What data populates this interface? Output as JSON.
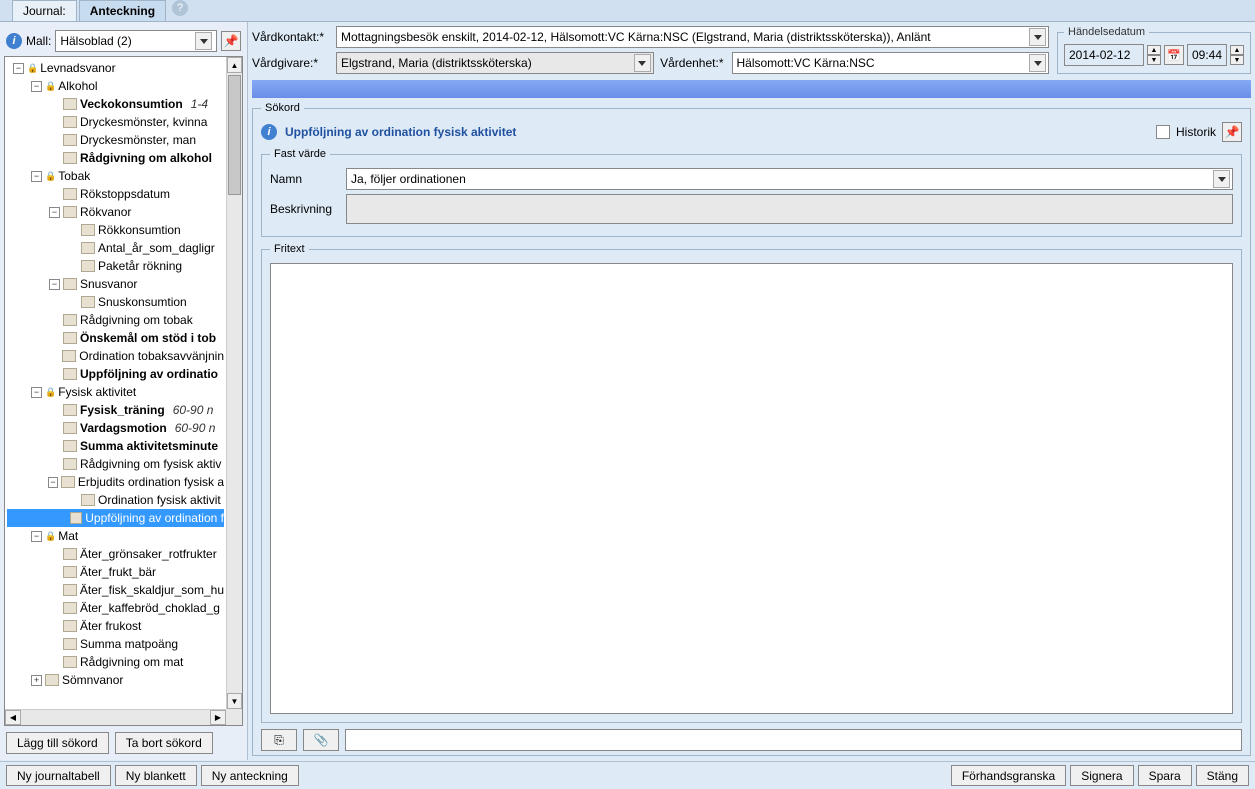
{
  "tabs": {
    "journal": "Journal:",
    "anteckning": "Anteckning"
  },
  "mall": {
    "label": "Mall:",
    "value": "Hälsoblad (2)"
  },
  "tree": [
    {
      "indent": 0,
      "toggle": "-",
      "lock": true,
      "label": "Levnadsvanor"
    },
    {
      "indent": 1,
      "toggle": "-",
      "lock": true,
      "label": "Alkohol"
    },
    {
      "indent": 2,
      "doc": true,
      "label": "Veckokonsumtion",
      "bold": true,
      "extra": "1-4"
    },
    {
      "indent": 2,
      "doc": true,
      "label": "Dryckesmönster, kvinna"
    },
    {
      "indent": 2,
      "doc": true,
      "label": "Dryckesmönster, man"
    },
    {
      "indent": 2,
      "doc": true,
      "label": "Rådgivning om alkohol",
      "bold": true
    },
    {
      "indent": 1,
      "toggle": "-",
      "lock": true,
      "label": "Tobak"
    },
    {
      "indent": 2,
      "doc": true,
      "label": "Rökstoppsdatum"
    },
    {
      "indent": 2,
      "toggle": "-",
      "doc": true,
      "label": "Rökvanor"
    },
    {
      "indent": 3,
      "doc": true,
      "label": "Rökkonsumtion"
    },
    {
      "indent": 3,
      "doc": true,
      "label": "Antal_år_som_dagligr"
    },
    {
      "indent": 3,
      "doc": true,
      "label": "Paketår rökning"
    },
    {
      "indent": 2,
      "toggle": "-",
      "doc": true,
      "label": "Snusvanor"
    },
    {
      "indent": 3,
      "doc": true,
      "label": "Snuskonsumtion"
    },
    {
      "indent": 2,
      "doc": true,
      "label": "Rådgivning om tobak"
    },
    {
      "indent": 2,
      "doc": true,
      "label": "Önskemål om stöd i tob",
      "bold": true
    },
    {
      "indent": 2,
      "doc": true,
      "label": "Ordination tobaksavvänjnin"
    },
    {
      "indent": 2,
      "doc": true,
      "label": "Uppföljning av ordinatio",
      "bold": true
    },
    {
      "indent": 1,
      "toggle": "-",
      "lock": true,
      "label": "Fysisk aktivitet"
    },
    {
      "indent": 2,
      "doc": true,
      "label": "Fysisk_träning",
      "bold": true,
      "extra": "60-90 n"
    },
    {
      "indent": 2,
      "doc": true,
      "label": "Vardagsmotion",
      "bold": true,
      "extra": "60-90 n"
    },
    {
      "indent": 2,
      "doc": true,
      "label": "Summa aktivitetsminute",
      "bold": true
    },
    {
      "indent": 2,
      "doc": true,
      "label": "Rådgivning om fysisk aktiv"
    },
    {
      "indent": 2,
      "toggle": "-",
      "doc": true,
      "label": "Erbjudits ordination fysisk a"
    },
    {
      "indent": 3,
      "doc": true,
      "label": "Ordination fysisk aktivit"
    },
    {
      "indent": 3,
      "doc": true,
      "label": "Uppföljning av ordination f",
      "selected": true
    },
    {
      "indent": 1,
      "toggle": "-",
      "lock": true,
      "label": "Mat"
    },
    {
      "indent": 2,
      "doc": true,
      "label": "Äter_grönsaker_rotfrukter"
    },
    {
      "indent": 2,
      "doc": true,
      "label": "Äter_frukt_bär"
    },
    {
      "indent": 2,
      "doc": true,
      "label": "Äter_fisk_skaldjur_som_hu"
    },
    {
      "indent": 2,
      "doc": true,
      "label": "Äter_kaffebröd_choklad_g"
    },
    {
      "indent": 2,
      "doc": true,
      "label": "Äter frukost"
    },
    {
      "indent": 2,
      "doc": true,
      "label": "Summa matpoäng"
    },
    {
      "indent": 2,
      "doc": true,
      "label": "Rådgivning om mat"
    },
    {
      "indent": 1,
      "toggle": "+",
      "doc": true,
      "label": "Sömnvanor"
    }
  ],
  "leftButtons": {
    "add": "Lägg till sökord",
    "remove": "Ta bort sökord"
  },
  "form": {
    "vardkontakt_label": "Vårdkontakt:*",
    "vardkontakt_value": "Mottagningsbesök enskilt, 2014-02-12, Hälsomott:VC Kärna:NSC (Elgstrand, Maria (distriktssköterska)), Anlänt",
    "vardgivare_label": "Vårdgivare:*",
    "vardgivare_value": "Elgstrand, Maria (distriktssköterska)",
    "vardenhet_label": "Vårdenhet:*",
    "vardenhet_value": "Hälsomott:VC Kärna:NSC",
    "handelsedatum_legend": "Händelsedatum",
    "date": "2014-02-12",
    "time": "09:44"
  },
  "sokord": {
    "legend": "Sökord",
    "title": "Uppföljning av ordination fysisk aktivitet",
    "historik": "Historik",
    "fast_legend": "Fast värde",
    "namn_label": "Namn",
    "namn_value": "Ja, följer ordinationen",
    "beskrivning_label": "Beskrivning",
    "fritext_legend": "Fritext"
  },
  "bottom": {
    "ny_journaltabell": "Ny journaltabell",
    "ny_blankett": "Ny blankett",
    "ny_anteckning": "Ny anteckning",
    "forhandsgranska": "Förhandsgranska",
    "signera": "Signera",
    "spara": "Spara",
    "stang": "Stäng"
  }
}
